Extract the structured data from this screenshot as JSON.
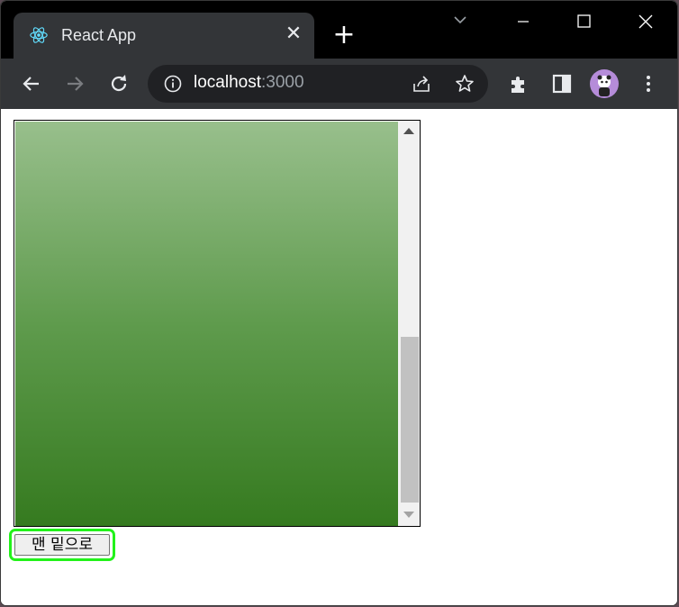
{
  "browser": {
    "tab_title": "React App",
    "tab_close": "✕",
    "new_tab": "+",
    "url_host": "localhost",
    "url_port": ":3000"
  },
  "page": {
    "button_label": "맨 밑으로",
    "scroll_position_fraction": 1.0
  },
  "colors": {
    "gradient_top": "#98bf8c",
    "gradient_bottom": "#357a1f",
    "focus_outline": "#22f21a",
    "avatar_bg": "#b58cd9"
  },
  "icons": [
    "react-icon",
    "back-arrow-icon",
    "forward-arrow-icon",
    "reload-icon",
    "info-icon",
    "share-icon",
    "star-icon",
    "extensions-icon",
    "side-panel-icon",
    "menu-icon",
    "minimize-icon",
    "maximize-icon",
    "close-icon",
    "tab-search-icon"
  ]
}
